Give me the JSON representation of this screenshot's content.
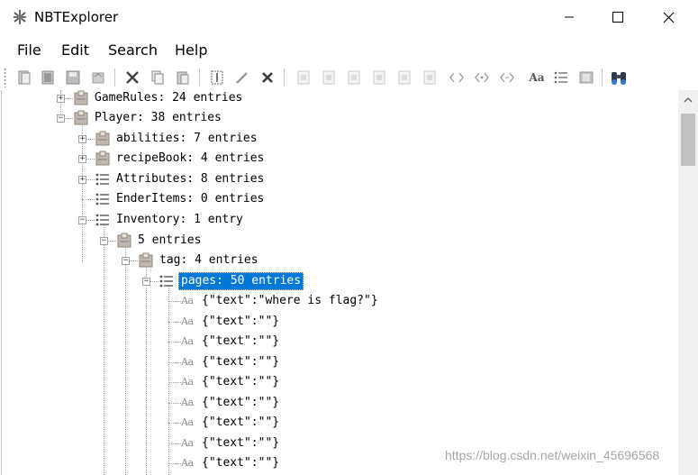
{
  "window": {
    "title": "NBTExplorer",
    "minimize_icon": "minimize-icon",
    "maximize_icon": "maximize-icon",
    "close_icon": "close-icon"
  },
  "menu": {
    "file": "File",
    "edit": "Edit",
    "search": "Search",
    "help": "Help"
  },
  "toolbar": {
    "icons": [
      "open-file-icon",
      "open-folder-icon",
      "save-icon",
      "refresh-icon",
      "cut-icon",
      "copy-icon",
      "paste-icon",
      "rename-icon",
      "edit-icon",
      "delete-icon",
      "add-byte-icon",
      "add-short-icon",
      "add-int-icon",
      "add-long-icon",
      "add-float-icon",
      "add-double-icon",
      "add-byte-array-icon",
      "add-int-array-icon",
      "add-long-array-icon",
      "add-string-icon",
      "add-list-icon",
      "add-compound-icon",
      "find-icon"
    ],
    "string_tag_glyph": "Aa"
  },
  "tree": {
    "nodes": [
      {
        "label": "GameRules: 24 entries",
        "icon": "compound-icon",
        "expander": "+"
      },
      {
        "label": "Player: 38 entries",
        "icon": "compound-icon",
        "expander": "−"
      },
      {
        "label": "abilities: 7 entries",
        "icon": "compound-icon",
        "expander": "+"
      },
      {
        "label": "recipeBook: 4 entries",
        "icon": "compound-icon",
        "expander": "+"
      },
      {
        "label": "Attributes: 8 entries",
        "icon": "list-icon",
        "expander": "+"
      },
      {
        "label": "EnderItems: 0 entries",
        "icon": "list-icon",
        "expander": ""
      },
      {
        "label": "Inventory: 1 entry",
        "icon": "list-icon",
        "expander": "−"
      },
      {
        "label": "5 entries",
        "icon": "compound-icon",
        "expander": "−"
      },
      {
        "label": "tag: 4 entries",
        "icon": "compound-icon",
        "expander": "−"
      },
      {
        "label": "pages: 50 entries",
        "icon": "list-icon",
        "expander": "−",
        "selected": true
      }
    ],
    "pages": [
      "{\"text\":\"where is flag?\"}",
      "{\"text\":\"\"}",
      "{\"text\":\"\"}",
      "{\"text\":\"\"}",
      "{\"text\":\"\"}",
      "{\"text\":\"\"}",
      "{\"text\":\"\"}",
      "{\"text\":\"\"}",
      "{\"text\":\"\"}"
    ]
  },
  "watermark": "https://blog.csdn.net/weixin_45696568",
  "colors": {
    "selection": "#0078d7",
    "tree_lines": "#a0a0a0"
  }
}
